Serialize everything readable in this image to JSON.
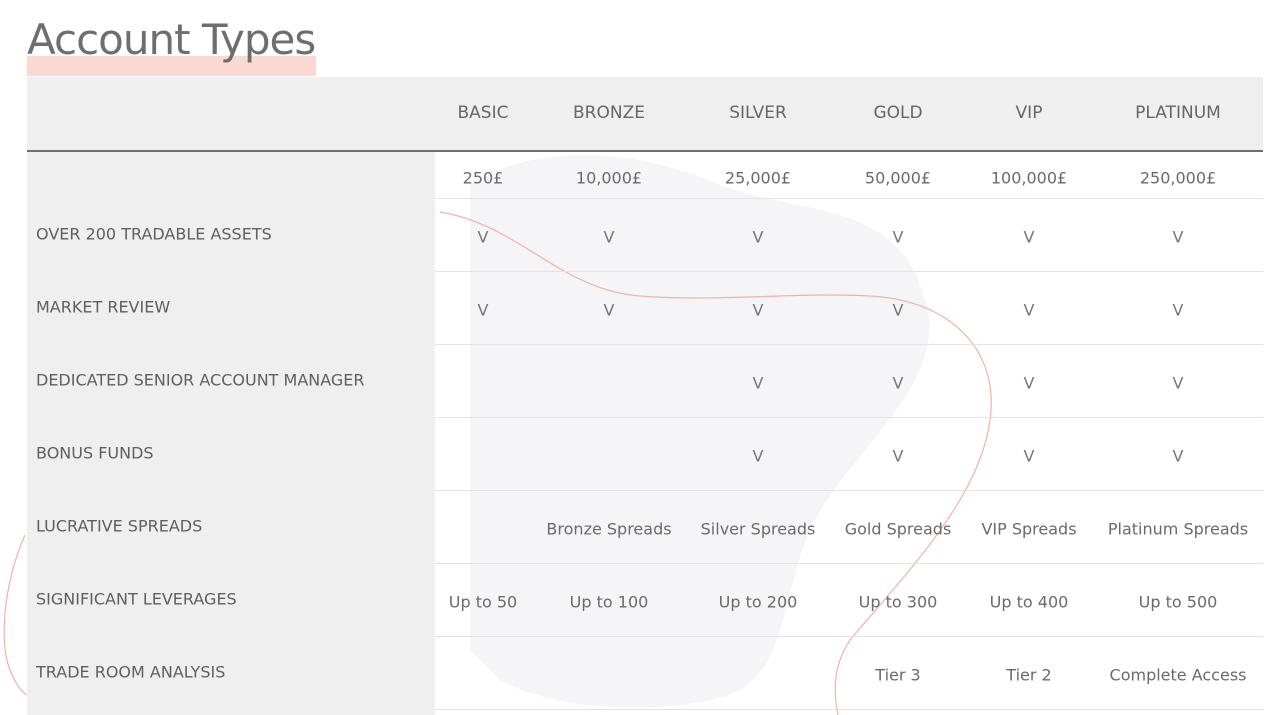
{
  "page": {
    "title": "Account Types"
  },
  "colors": {
    "title": "#6e6e6e",
    "title_underline": "#fbd9d3",
    "header_bg": "#efefef",
    "label_bg": "#efefef",
    "text": "#666666",
    "decor_line": "#f2b2a8",
    "decor_blob": "#f5f5f7"
  },
  "table": {
    "tiers": [
      "BASIC",
      "BRONZE",
      "SILVER",
      "GOLD",
      "VIP",
      "PLATINUM"
    ],
    "rows": [
      {
        "label": "",
        "cells": [
          "250£",
          "10,000£",
          "25,000£",
          "50,000£",
          "100,000£",
          "250,000£"
        ]
      },
      {
        "label": "OVER 200 TRADABLE ASSETS",
        "cells": [
          "V",
          "V",
          "V",
          "V",
          "V",
          "V"
        ]
      },
      {
        "label": "MARKET REVIEW",
        "cells": [
          "V",
          "V",
          "V",
          "V",
          "V",
          "V"
        ]
      },
      {
        "label": "DEDICATED SENIOR ACCOUNT MANAGER",
        "cells": [
          "",
          "",
          "V",
          "V",
          "V",
          "V"
        ]
      },
      {
        "label": "BONUS FUNDS",
        "cells": [
          "",
          "",
          "V",
          "V",
          "V",
          "V"
        ]
      },
      {
        "label": "LUCRATIVE SPREADS",
        "cells": [
          "",
          "Bronze Spreads",
          "Silver Spreads",
          "Gold Spreads",
          "VIP Spreads",
          "Platinum Spreads"
        ]
      },
      {
        "label": "SIGNIFICANT LEVERAGES",
        "cells": [
          "Up to 50",
          "Up to 100",
          "Up to 200",
          "Up to 300",
          "Up to 400",
          "Up to 500"
        ]
      },
      {
        "label": "TRADE ROOM ANALYSIS",
        "cells": [
          "",
          "",
          "",
          "Tier 3",
          "Tier 2",
          "Complete Access"
        ]
      }
    ]
  }
}
